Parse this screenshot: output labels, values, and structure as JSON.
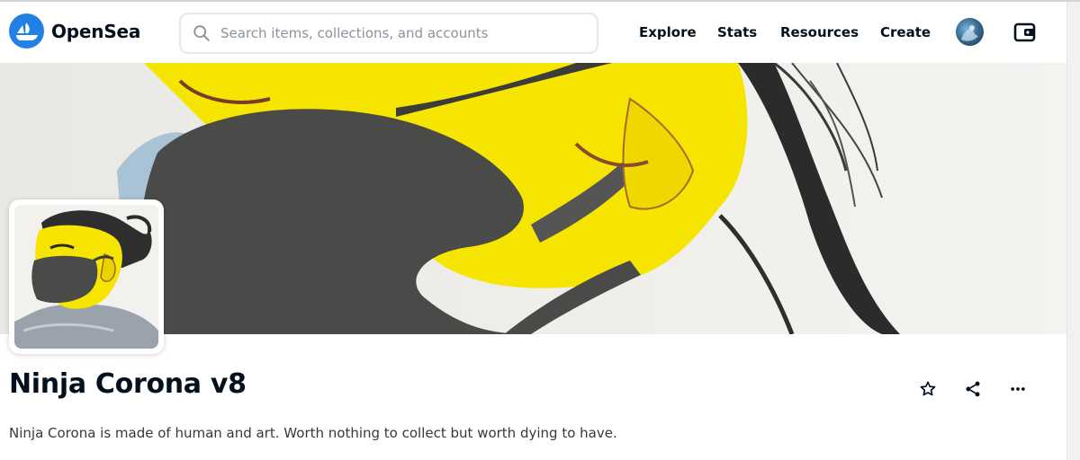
{
  "brand": {
    "name": "OpenSea",
    "logo_icon": "opensea-logo-icon",
    "accent": "#2081e2"
  },
  "search": {
    "placeholder": "Search items, collections, and accounts",
    "value": ""
  },
  "nav": {
    "explore": "Explore",
    "stats": "Stats",
    "resources": "Resources",
    "create": "Create"
  },
  "account": {
    "avatar_icon": "user-avatar-icon",
    "wallet_icon": "wallet-icon"
  },
  "collection": {
    "title": "Ninja Corona v8",
    "description": "Ninja Corona is made of human and art. Worth nothing to collect but worth dying to have.",
    "banner_image": "collection-banner",
    "profile_image": "collection-profile-picture"
  },
  "actions": [
    {
      "name": "favorite",
      "icon": "star-icon"
    },
    {
      "name": "share",
      "icon": "share-icon"
    },
    {
      "name": "more",
      "icon": "more-horizontal-icon"
    }
  ],
  "colors": {
    "text": "#04111d",
    "muted": "#8a939b",
    "banner_yellow": "#f7e600",
    "mask": "#4a4a48"
  }
}
